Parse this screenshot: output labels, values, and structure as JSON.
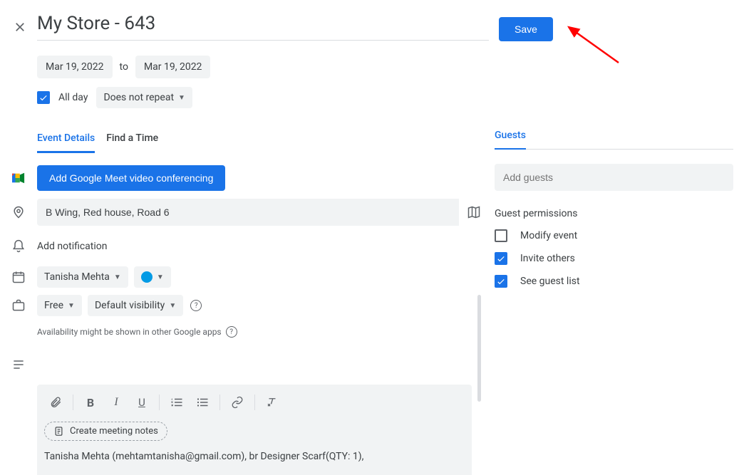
{
  "header": {
    "title": "My Store - 643",
    "save_label": "Save"
  },
  "dates": {
    "start": "Mar 19, 2022",
    "to_label": "to",
    "end": "Mar 19, 2022"
  },
  "allday": {
    "label": "All day",
    "checked": true
  },
  "recurrence": {
    "label": "Does not repeat"
  },
  "tabs": {
    "event_details": "Event Details",
    "find_a_time": "Find a Time"
  },
  "meet": {
    "button_label": "Add Google Meet video conferencing"
  },
  "location": {
    "value": "B Wing, Red house, Road 6"
  },
  "notification": {
    "label": "Add notification"
  },
  "calendar": {
    "owner": "Tanisha Mehta",
    "color": "#039be5"
  },
  "availability": {
    "status": "Free",
    "visibility": "Default visibility",
    "hint": "Availability might be shown in other Google apps"
  },
  "editor": {
    "meeting_notes_label": "Create meeting notes",
    "description": "Tanisha Mehta (mehtamtanisha@gmail.com), br Designer Scarf(QTY: 1),"
  },
  "guests": {
    "header": "Guests",
    "placeholder": "Add guests",
    "permissions_title": "Guest permissions",
    "perm_modify": {
      "label": "Modify event",
      "checked": false
    },
    "perm_invite": {
      "label": "Invite others",
      "checked": true
    },
    "perm_seelist": {
      "label": "See guest list",
      "checked": true
    }
  }
}
